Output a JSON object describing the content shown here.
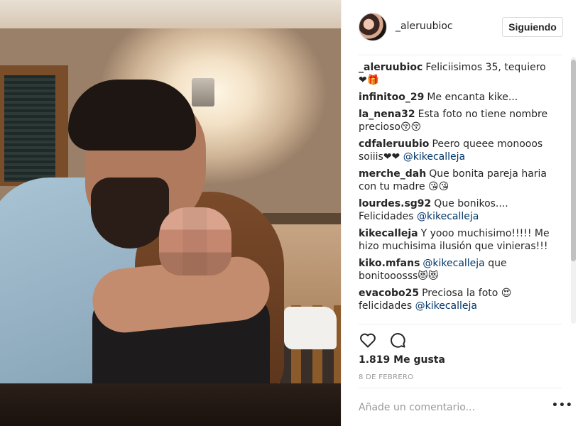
{
  "post": {
    "username": "_aleruubioc",
    "follow_label": "Siguiendo",
    "likes": "1.819 Me gusta",
    "date": "8 DE FEBRERO",
    "comment_placeholder": "Añade un comentario...",
    "more_label": "•••"
  },
  "comments": [
    {
      "user": "_aleruubioc",
      "text": "Feliciisimos 35, tequiero❤🎁",
      "mention": ""
    },
    {
      "user": "infinitoo_29",
      "text": "Me encanta kike...",
      "mention": ""
    },
    {
      "user": "la_nena32",
      "text": "Esta foto no tiene nombre precioso😚😚",
      "mention": ""
    },
    {
      "user": "cdfaleruubio",
      "text": "Peero queee monooos soiiis❤❤",
      "mention": "@kikecalleja"
    },
    {
      "user": "merche_dah",
      "text": "Que bonita pareja haria con tu madre 😘😘",
      "mention": ""
    },
    {
      "user": "lourdes.sg92",
      "text": "Que bonikos.... Felicidades",
      "mention": "@kikecalleja"
    },
    {
      "user": "kikecalleja",
      "text": "Y yooo muchisimo!!!!! Me hizo muchisima ilusión que vinieras!!!",
      "mention": ""
    },
    {
      "user": "kiko.mfans",
      "text": "",
      "mention": "@kikecalleja",
      "after": "que bonitooosss😻😻"
    },
    {
      "user": "evacobo25",
      "text": "Preciosa la foto 😍 felicidades",
      "mention": "@kikecalleja"
    }
  ],
  "icons": {
    "like": "heart-icon",
    "comment": "comment-icon",
    "more": "more-options-icon"
  },
  "colors": {
    "mention": "#003569",
    "secondary_text": "#999999",
    "border": "#efefef"
  }
}
